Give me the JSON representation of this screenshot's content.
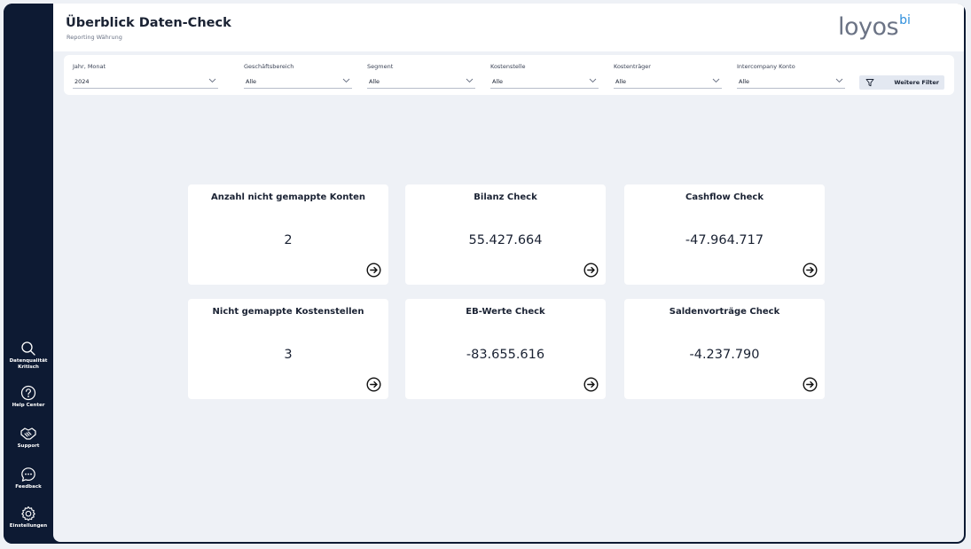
{
  "header": {
    "title": "Überblick Daten-Check",
    "subtitle": "Reporting Währung",
    "logo_text": "loyos",
    "logo_sup": "bi"
  },
  "sidebar": {
    "items": [
      {
        "label": "Datenqualität Kritisch",
        "icon": "search-icon"
      },
      {
        "label": "Help Center",
        "icon": "help-icon"
      },
      {
        "label": "Support",
        "icon": "handshake-icon"
      },
      {
        "label": "Feedback",
        "icon": "chat-bubble-icon"
      },
      {
        "label": "Einstellungen",
        "icon": "gear-icon"
      }
    ]
  },
  "filters": [
    {
      "label": "Jahr, Monat",
      "value": "2024"
    },
    {
      "label": "Geschäftsbereich",
      "value": "Alle"
    },
    {
      "label": "Segment",
      "value": "Alle"
    },
    {
      "label": "Kostenstelle",
      "value": "Alle"
    },
    {
      "label": "Kostenträger",
      "value": "Alle"
    },
    {
      "label": "Intercompany Konto",
      "value": "Alle"
    }
  ],
  "more_filters_label": "Weitere Filter",
  "cards": [
    {
      "title": "Anzahl nicht gemappte Konten",
      "value": "2"
    },
    {
      "title": "Bilanz Check",
      "value": "55.427.664"
    },
    {
      "title": "Cashflow Check",
      "value": "-47.964.717"
    },
    {
      "title": "Nicht gemappte Kostenstellen",
      "value": "3"
    },
    {
      "title": "EB-Werte Check",
      "value": "-83.655.616"
    },
    {
      "title": "Saldenvorträge Check",
      "value": "-4.237.790"
    }
  ],
  "colors": {
    "sidebar_bg": "#0d1a33",
    "canvas_bg": "#eef1f6",
    "card_bg": "#ffffff",
    "logo_accent": "#2f8fdc",
    "text": "#1a2233"
  }
}
